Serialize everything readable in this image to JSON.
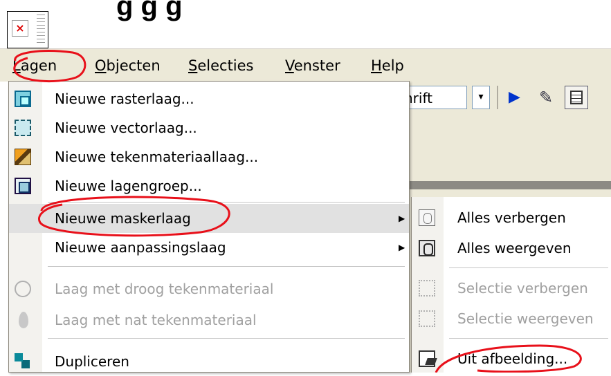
{
  "title_fragment": "g                    g           g",
  "menubar": {
    "items": [
      {
        "label": "Lagen",
        "accel_index": 0
      },
      {
        "label": "Objecten",
        "accel_index": 0
      },
      {
        "label": "Selecties",
        "accel_index": 0
      },
      {
        "label": "Venster",
        "accel_index": 0
      },
      {
        "label": "Help",
        "accel_index": 0
      }
    ]
  },
  "toolbar": {
    "combo_value": "hrift"
  },
  "menu": {
    "items": [
      {
        "label": "Nieuwe rasterlaag...",
        "icon": "raster-layer-icon",
        "disabled": false
      },
      {
        "label": "Nieuwe vectorlaag...",
        "icon": "vector-layer-icon",
        "disabled": false
      },
      {
        "label": "Nieuwe tekenmateriaallaag...",
        "icon": "art-media-layer-icon",
        "disabled": false
      },
      {
        "label": "Nieuwe lagengroep...",
        "icon": "layer-group-icon",
        "disabled": false
      },
      {
        "label": "Nieuwe maskerlaag",
        "icon": "",
        "disabled": false,
        "submenu": true
      },
      {
        "label": "Nieuwe aanpassingslaag",
        "icon": "",
        "disabled": false,
        "submenu": true
      },
      {
        "label": "Laag met droog tekenmateriaal",
        "icon": "dry-media-icon",
        "disabled": true
      },
      {
        "label": "Laag met nat tekenmateriaal",
        "icon": "wet-media-icon",
        "disabled": true
      },
      {
        "label": "Dupliceren",
        "icon": "duplicate-icon",
        "disabled": false
      }
    ]
  },
  "submenu": {
    "items": [
      {
        "label": "Alles verbergen",
        "icon": "hide-all-mask-icon",
        "disabled": false
      },
      {
        "label": "Alles weergeven",
        "icon": "show-all-mask-icon",
        "disabled": false
      },
      {
        "label": "Selectie verbergen",
        "icon": "hide-selection-icon",
        "disabled": true
      },
      {
        "label": "Selectie weergeven",
        "icon": "show-selection-icon",
        "disabled": true
      },
      {
        "label": "Uit afbeelding...",
        "icon": "from-image-icon",
        "disabled": false
      }
    ]
  },
  "colors": {
    "annotation": "#e8101a",
    "menu_bg": "#ffffff",
    "chrome": "#ece9d8"
  }
}
